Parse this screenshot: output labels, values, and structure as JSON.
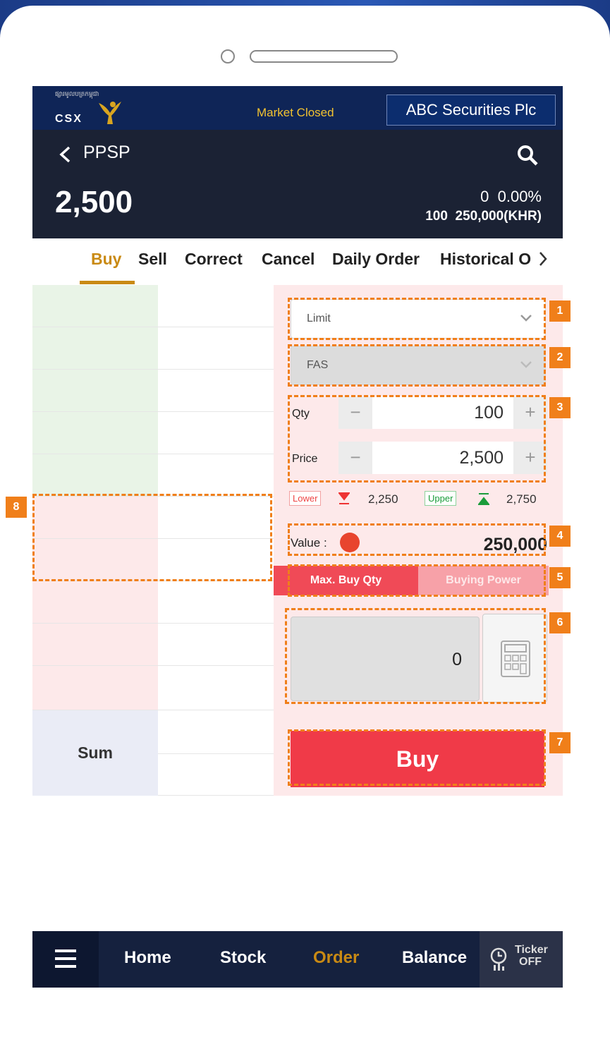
{
  "header": {
    "logo_khmer": "ផ្សារមូលបត្រកម្ពុជា",
    "logo_text": "CSX",
    "market_status": "Market Closed",
    "broker": "ABC Securities Plc"
  },
  "stock": {
    "symbol": "PPSP",
    "price": "2,500",
    "change": "0",
    "change_pct": "0.00%",
    "volume": "100",
    "trade_value": "250,000(KHR)"
  },
  "tabs": [
    {
      "label": "Buy"
    },
    {
      "label": "Sell"
    },
    {
      "label": "Correct"
    },
    {
      "label": "Cancel"
    },
    {
      "label": "Daily Order"
    },
    {
      "label": "Historical Order"
    }
  ],
  "order": {
    "order_type": "Limit",
    "account_type": "FAS",
    "qty_label": "Qty",
    "qty": "100",
    "price_label": "Price",
    "price": "2,500",
    "minus": "−",
    "plus": "+",
    "lower_label": "Lower",
    "lower_value": "2,250",
    "upper_label": "Upper",
    "upper_value": "2,750",
    "value_label": "Value :",
    "value": "250,000",
    "toggle_max": "Max. Buy Qty",
    "toggle_power": "Buying Power",
    "result": "0",
    "buy_button": "Buy"
  },
  "orderbook": {
    "sum_label": "Sum"
  },
  "annotations": [
    "1",
    "2",
    "3",
    "4",
    "5",
    "6",
    "7",
    "8"
  ],
  "bottom_nav": {
    "items": [
      "Home",
      "Stock",
      "Order",
      "Balance"
    ],
    "ticker": [
      "Ticker",
      "OFF"
    ]
  },
  "colors": {
    "accent": "#c98a14",
    "buy": "#f03a48",
    "annotation": "#f07f1a",
    "header": "#0f2557"
  }
}
